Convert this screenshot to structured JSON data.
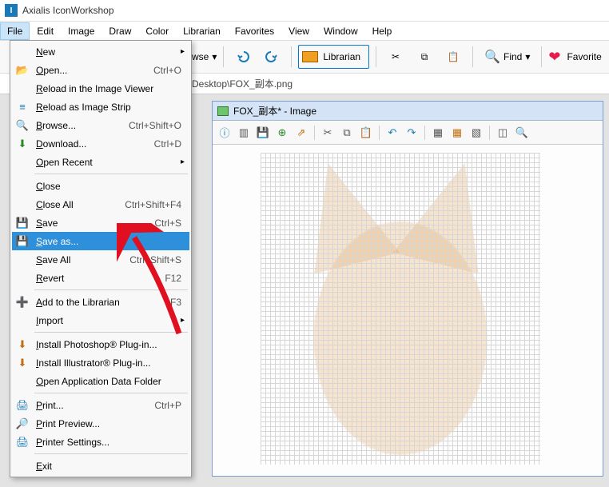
{
  "app": {
    "title": "Axialis IconWorkshop"
  },
  "menubar": [
    "File",
    "Edit",
    "Image",
    "Draw",
    "Color",
    "Librarian",
    "Favorites",
    "View",
    "Window",
    "Help"
  ],
  "toolbar": {
    "wse_label": "wse",
    "librarian_label": "Librarian",
    "find_label": "Find",
    "favorite_label": "Favorite"
  },
  "address": {
    "path": "Desktop\\FOX_副本.png"
  },
  "document": {
    "title": "FOX_副本* - Image"
  },
  "file_menu": {
    "items": [
      {
        "key": "new",
        "label": "New",
        "shortcut": "",
        "submenu": true,
        "icon": ""
      },
      {
        "key": "open",
        "label": "Open...",
        "shortcut": "Ctrl+O",
        "icon": "📂",
        "icon_cls": "col-orange"
      },
      {
        "key": "reload_viewer",
        "label": "Reload in the Image Viewer",
        "icon": ""
      },
      {
        "key": "reload_strip",
        "label": "Reload as Image Strip",
        "icon": "≡",
        "icon_cls": "col-blue"
      },
      {
        "key": "browse",
        "label": "Browse...",
        "shortcut": "Ctrl+Shift+O",
        "icon": "🔍",
        "icon_cls": "col-blue"
      },
      {
        "key": "download",
        "label": "Download...",
        "shortcut": "Ctrl+D",
        "icon": "⬇",
        "icon_cls": "col-green"
      },
      {
        "key": "open_recent",
        "label": "Open Recent",
        "submenu": true,
        "icon": ""
      },
      {
        "key": "sep1",
        "sep": true
      },
      {
        "key": "close",
        "label": "Close",
        "icon": ""
      },
      {
        "key": "close_all",
        "label": "Close All",
        "shortcut": "Ctrl+Shift+F4",
        "icon": ""
      },
      {
        "key": "save",
        "label": "Save",
        "shortcut": "Ctrl+S",
        "icon": "💾",
        "icon_cls": "col-purple"
      },
      {
        "key": "save_as",
        "label": "Save as...",
        "shortcut": "",
        "icon": "💾",
        "icon_cls": "col-purple",
        "selected": true
      },
      {
        "key": "save_all",
        "label": "Save All",
        "shortcut": "Ctrl+Shift+S",
        "icon": ""
      },
      {
        "key": "revert",
        "label": "Revert",
        "shortcut": "F12",
        "icon": ""
      },
      {
        "key": "sep2",
        "sep": true
      },
      {
        "key": "add_librarian",
        "label": "Add to the Librarian",
        "shortcut": "F3",
        "icon": "➕",
        "icon_cls": "col-green"
      },
      {
        "key": "import",
        "label": "Import",
        "submenu": true,
        "icon": ""
      },
      {
        "key": "sep3",
        "sep": true
      },
      {
        "key": "install_ps",
        "label": "Install Photoshop® Plug-in...",
        "icon": "⬇",
        "icon_cls": "col-orange"
      },
      {
        "key": "install_ai",
        "label": "Install Illustrator® Plug-in...",
        "icon": "⬇",
        "icon_cls": "col-orange"
      },
      {
        "key": "open_appdata",
        "label": "Open Application Data Folder",
        "icon": ""
      },
      {
        "key": "sep4",
        "sep": true
      },
      {
        "key": "print",
        "label": "Print...",
        "shortcut": "Ctrl+P",
        "icon": "🖨",
        "icon_cls": "col-blue"
      },
      {
        "key": "print_preview",
        "label": "Print Preview...",
        "icon": "🔎",
        "icon_cls": "col-blue"
      },
      {
        "key": "printer_settings",
        "label": "Printer Settings...",
        "icon": "🖨",
        "icon_cls": "col-blue"
      },
      {
        "key": "sep5",
        "sep": true
      },
      {
        "key": "exit",
        "label": "Exit",
        "icon": ""
      }
    ]
  }
}
